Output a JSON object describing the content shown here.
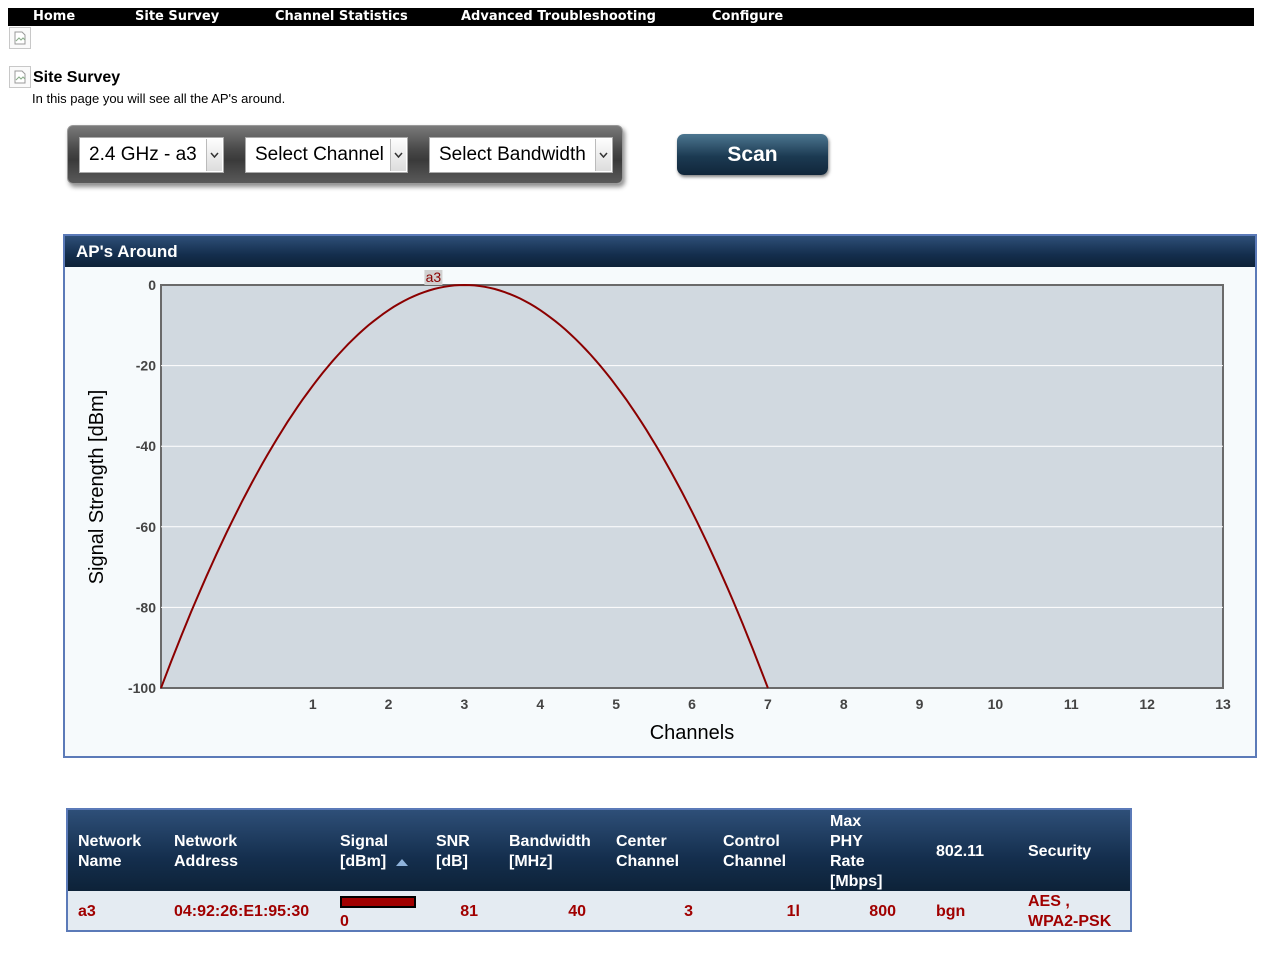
{
  "nav": {
    "home": "Home",
    "site_survey": "Site Survey",
    "channel_statistics": "Channel Statistics",
    "advanced_troubleshooting": "Advanced Troubleshooting",
    "configure": "Configure"
  },
  "page": {
    "title": "Site Survey",
    "description": "In this page you will see all the AP's around."
  },
  "filters": {
    "band": "2.4 GHz - a3",
    "channel": "Select Channel",
    "bandwidth": "Select Bandwidth"
  },
  "scan_label": "Scan",
  "panel_title": "AP's Around",
  "chart_data": {
    "type": "area",
    "xlabel": "Channels",
    "ylabel": "Signal Strength [dBm]",
    "xlim": [
      -1,
      13
    ],
    "ylim": [
      -100,
      0
    ],
    "xticks": [
      1,
      2,
      3,
      4,
      5,
      6,
      7,
      8,
      9,
      10,
      11,
      12,
      13
    ],
    "yticks": [
      0,
      -20,
      -40,
      -60,
      -80,
      -100
    ],
    "grid": true,
    "series": [
      {
        "name": "a3",
        "center": 3,
        "peak": 0,
        "x": [
          -1,
          0,
          1,
          2,
          3,
          4,
          5,
          6,
          7
        ],
        "values": [
          -100,
          -57,
          -25,
          -6,
          0,
          -6,
          -25,
          -57,
          -100
        ],
        "color": "#8b0000"
      }
    ]
  },
  "table": {
    "headers": {
      "name": [
        "Network",
        "Name"
      ],
      "address": [
        "Network",
        "Address"
      ],
      "signal": [
        "Signal",
        "[dBm]"
      ],
      "snr": [
        "SNR",
        "[dB]"
      ],
      "bandwidth": [
        "Bandwidth",
        "[MHz]"
      ],
      "center": [
        "Center",
        "Channel"
      ],
      "control": [
        "Control",
        "Channel"
      ],
      "rate": [
        "Max",
        "PHY",
        "Rate",
        "[Mbps]"
      ],
      "mode": "802.11",
      "security": "Security"
    },
    "rows": [
      {
        "name": "a3",
        "address": "04:92:26:E1:95:30",
        "signal": "0",
        "signal_level": 1.0,
        "snr": "81",
        "bandwidth": "40",
        "center": "3",
        "control": "1l",
        "rate": "800",
        "mode": "bgn",
        "security": [
          "AES ,",
          "WPA2-PSK"
        ]
      }
    ]
  },
  "colors": {
    "nav_bg": "#000000",
    "header_bg": "#142e4d",
    "accent_red": "#a00000",
    "panel_border": "#5b7ab8"
  }
}
